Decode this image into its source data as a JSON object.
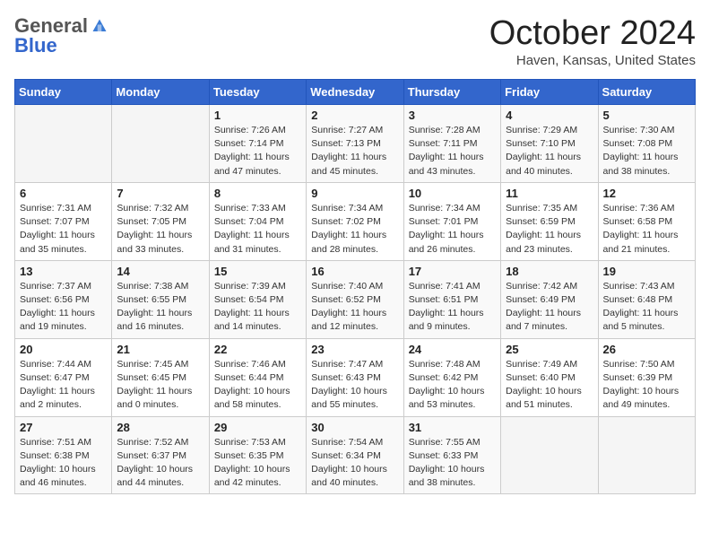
{
  "header": {
    "logo_general": "General",
    "logo_blue": "Blue",
    "month_title": "October 2024",
    "location": "Haven, Kansas, United States"
  },
  "columns": [
    "Sunday",
    "Monday",
    "Tuesday",
    "Wednesday",
    "Thursday",
    "Friday",
    "Saturday"
  ],
  "weeks": [
    [
      {
        "day": "",
        "info": ""
      },
      {
        "day": "",
        "info": ""
      },
      {
        "day": "1",
        "info": "Sunrise: 7:26 AM\nSunset: 7:14 PM\nDaylight: 11 hours and 47 minutes."
      },
      {
        "day": "2",
        "info": "Sunrise: 7:27 AM\nSunset: 7:13 PM\nDaylight: 11 hours and 45 minutes."
      },
      {
        "day": "3",
        "info": "Sunrise: 7:28 AM\nSunset: 7:11 PM\nDaylight: 11 hours and 43 minutes."
      },
      {
        "day": "4",
        "info": "Sunrise: 7:29 AM\nSunset: 7:10 PM\nDaylight: 11 hours and 40 minutes."
      },
      {
        "day": "5",
        "info": "Sunrise: 7:30 AM\nSunset: 7:08 PM\nDaylight: 11 hours and 38 minutes."
      }
    ],
    [
      {
        "day": "6",
        "info": "Sunrise: 7:31 AM\nSunset: 7:07 PM\nDaylight: 11 hours and 35 minutes."
      },
      {
        "day": "7",
        "info": "Sunrise: 7:32 AM\nSunset: 7:05 PM\nDaylight: 11 hours and 33 minutes."
      },
      {
        "day": "8",
        "info": "Sunrise: 7:33 AM\nSunset: 7:04 PM\nDaylight: 11 hours and 31 minutes."
      },
      {
        "day": "9",
        "info": "Sunrise: 7:34 AM\nSunset: 7:02 PM\nDaylight: 11 hours and 28 minutes."
      },
      {
        "day": "10",
        "info": "Sunrise: 7:34 AM\nSunset: 7:01 PM\nDaylight: 11 hours and 26 minutes."
      },
      {
        "day": "11",
        "info": "Sunrise: 7:35 AM\nSunset: 6:59 PM\nDaylight: 11 hours and 23 minutes."
      },
      {
        "day": "12",
        "info": "Sunrise: 7:36 AM\nSunset: 6:58 PM\nDaylight: 11 hours and 21 minutes."
      }
    ],
    [
      {
        "day": "13",
        "info": "Sunrise: 7:37 AM\nSunset: 6:56 PM\nDaylight: 11 hours and 19 minutes."
      },
      {
        "day": "14",
        "info": "Sunrise: 7:38 AM\nSunset: 6:55 PM\nDaylight: 11 hours and 16 minutes."
      },
      {
        "day": "15",
        "info": "Sunrise: 7:39 AM\nSunset: 6:54 PM\nDaylight: 11 hours and 14 minutes."
      },
      {
        "day": "16",
        "info": "Sunrise: 7:40 AM\nSunset: 6:52 PM\nDaylight: 11 hours and 12 minutes."
      },
      {
        "day": "17",
        "info": "Sunrise: 7:41 AM\nSunset: 6:51 PM\nDaylight: 11 hours and 9 minutes."
      },
      {
        "day": "18",
        "info": "Sunrise: 7:42 AM\nSunset: 6:49 PM\nDaylight: 11 hours and 7 minutes."
      },
      {
        "day": "19",
        "info": "Sunrise: 7:43 AM\nSunset: 6:48 PM\nDaylight: 11 hours and 5 minutes."
      }
    ],
    [
      {
        "day": "20",
        "info": "Sunrise: 7:44 AM\nSunset: 6:47 PM\nDaylight: 11 hours and 2 minutes."
      },
      {
        "day": "21",
        "info": "Sunrise: 7:45 AM\nSunset: 6:45 PM\nDaylight: 11 hours and 0 minutes."
      },
      {
        "day": "22",
        "info": "Sunrise: 7:46 AM\nSunset: 6:44 PM\nDaylight: 10 hours and 58 minutes."
      },
      {
        "day": "23",
        "info": "Sunrise: 7:47 AM\nSunset: 6:43 PM\nDaylight: 10 hours and 55 minutes."
      },
      {
        "day": "24",
        "info": "Sunrise: 7:48 AM\nSunset: 6:42 PM\nDaylight: 10 hours and 53 minutes."
      },
      {
        "day": "25",
        "info": "Sunrise: 7:49 AM\nSunset: 6:40 PM\nDaylight: 10 hours and 51 minutes."
      },
      {
        "day": "26",
        "info": "Sunrise: 7:50 AM\nSunset: 6:39 PM\nDaylight: 10 hours and 49 minutes."
      }
    ],
    [
      {
        "day": "27",
        "info": "Sunrise: 7:51 AM\nSunset: 6:38 PM\nDaylight: 10 hours and 46 minutes."
      },
      {
        "day": "28",
        "info": "Sunrise: 7:52 AM\nSunset: 6:37 PM\nDaylight: 10 hours and 44 minutes."
      },
      {
        "day": "29",
        "info": "Sunrise: 7:53 AM\nSunset: 6:35 PM\nDaylight: 10 hours and 42 minutes."
      },
      {
        "day": "30",
        "info": "Sunrise: 7:54 AM\nSunset: 6:34 PM\nDaylight: 10 hours and 40 minutes."
      },
      {
        "day": "31",
        "info": "Sunrise: 7:55 AM\nSunset: 6:33 PM\nDaylight: 10 hours and 38 minutes."
      },
      {
        "day": "",
        "info": ""
      },
      {
        "day": "",
        "info": ""
      }
    ]
  ]
}
